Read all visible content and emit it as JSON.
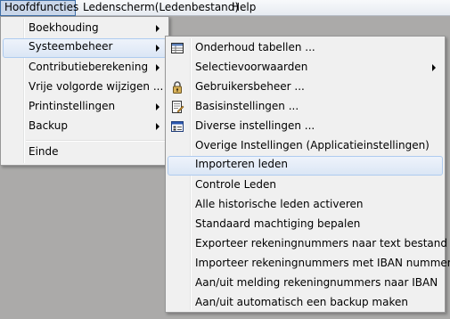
{
  "menubar": {
    "items": [
      {
        "label": "Hoofdfuncties"
      },
      {
        "label": "Ledenscherm(Ledenbestand)"
      },
      {
        "label": "Help"
      }
    ]
  },
  "main_menu": {
    "items": [
      {
        "label": "Boekhouding",
        "submenu": true
      },
      {
        "label": "Systeembeheer",
        "submenu": true,
        "highlighted": true
      },
      {
        "label": "Contributieberekening",
        "submenu": true
      },
      {
        "label": "Vrije volgorde wijzigen ...",
        "submenu": false
      },
      {
        "label": "Printinstellingen",
        "submenu": true
      },
      {
        "label": "Backup",
        "submenu": true
      },
      {
        "label": "Einde",
        "submenu": false
      }
    ]
  },
  "submenu": {
    "items": [
      {
        "label": "Onderhoud tabellen ...",
        "icon": "table-icon"
      },
      {
        "label": "Selectievoorwaarden",
        "submenu": true
      },
      {
        "label": "Gebruikersbeheer ...",
        "icon": "lock-icon"
      },
      {
        "label": "Basisinstellingen ...",
        "icon": "document-edit-icon"
      },
      {
        "label": "Diverse instellingen ...",
        "icon": "settings-window-icon"
      },
      {
        "label": "Overige Instellingen (Applicatieinstellingen)"
      },
      {
        "label": "Importeren leden",
        "highlighted": true
      },
      {
        "label": "Controle Leden"
      },
      {
        "label": "Alle historische leden activeren"
      },
      {
        "label": "Standaard machtiging bepalen"
      },
      {
        "label": "Exporteer rekeningnummers naar text bestand"
      },
      {
        "label": "Importeer rekeningnummers met IBAN nummer"
      },
      {
        "label": "Aan/uit melding rekeningnummers naar IBAN"
      },
      {
        "label": "Aan/uit automatisch een backup maken"
      }
    ]
  },
  "colors": {
    "background": "#abaaa9",
    "menu": "#f0f0f0",
    "highlight_border": "#aecbef",
    "highlight_fill": "#dbe6f5"
  }
}
